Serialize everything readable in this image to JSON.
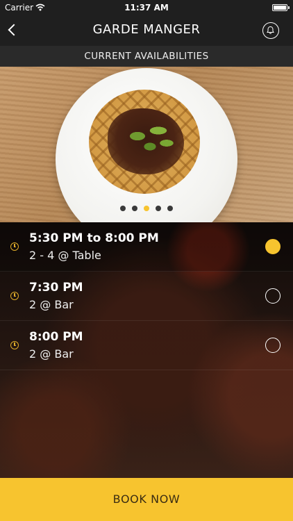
{
  "status_bar": {
    "carrier": "Carrier",
    "time": "11:37 AM"
  },
  "navbar": {
    "title": "GARDE MANGER",
    "back_icon": "chevron-left-icon",
    "bell_icon": "bell-icon"
  },
  "section": {
    "header": "CURRENT AVAILABILITIES"
  },
  "carousel": {
    "page_count": 5,
    "active_index": 2
  },
  "availabilities": [
    {
      "time": "5:30 PM to 8:00 PM",
      "detail": "2 - 4 @ Table",
      "selected": true
    },
    {
      "time": "7:30 PM",
      "detail": "2 @ Bar",
      "selected": false
    },
    {
      "time": "8:00 PM",
      "detail": "2 @ Bar",
      "selected": false
    }
  ],
  "actions": {
    "book_label": "BOOK NOW"
  },
  "colors": {
    "accent": "#f7c42f",
    "bar_background": "#1f1f1f",
    "section_background": "#2a2a2a"
  }
}
